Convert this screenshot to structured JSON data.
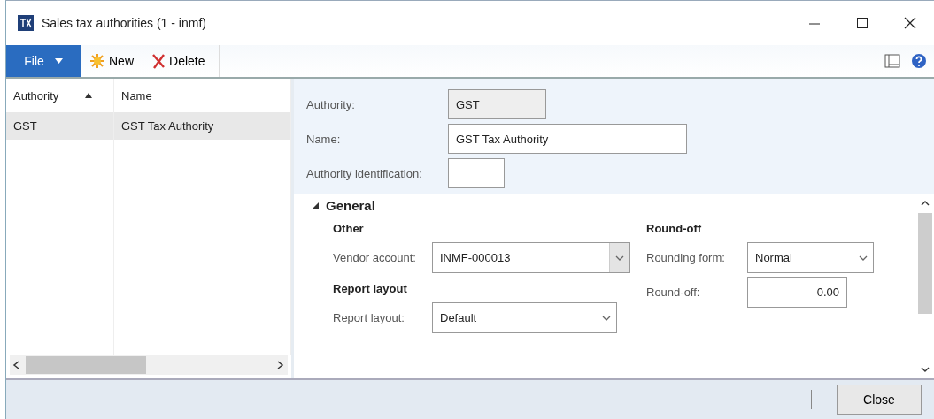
{
  "window": {
    "title": "Sales tax authorities (1 - inmf)"
  },
  "toolbar": {
    "file_menu": "File",
    "buttons": [
      {
        "label": "New",
        "kind": "new"
      },
      {
        "label": "Delete",
        "kind": "delete"
      }
    ]
  },
  "grid": {
    "columns": [
      {
        "label": "Authority",
        "sorted": true
      },
      {
        "label": "Name",
        "sorted": false
      }
    ],
    "rows": [
      {
        "cells": [
          "GST",
          "GST Tax Authority"
        ],
        "selected": true
      }
    ]
  },
  "header_fields": [
    {
      "label": "Authority:",
      "value": "GST",
      "kind": "readonly"
    },
    {
      "label": "Name:",
      "value": "GST Tax Authority",
      "kind": "text"
    },
    {
      "label": "Authority identification:",
      "kind": "text"
    }
  ],
  "section": {
    "title": "General",
    "expanded": true,
    "columns": [
      [
        {
          "title": "Other",
          "fields": [
            {
              "label": "Vendor account:",
              "value": "INMF-000013",
              "kind": "lookup"
            }
          ]
        },
        {
          "title": "Report layout",
          "fields": [
            {
              "label": "Report layout:",
              "value": "Default",
              "kind": "combo"
            }
          ]
        }
      ],
      [
        {
          "title": "Round-off",
          "fields": [
            {
              "label": "Rounding form:",
              "value": "Normal",
              "kind": "combo"
            },
            {
              "label": "Round-off:",
              "value": "0.00",
              "kind": "number"
            }
          ]
        }
      ]
    ]
  },
  "footer": {
    "buttons": [
      "Close"
    ]
  }
}
